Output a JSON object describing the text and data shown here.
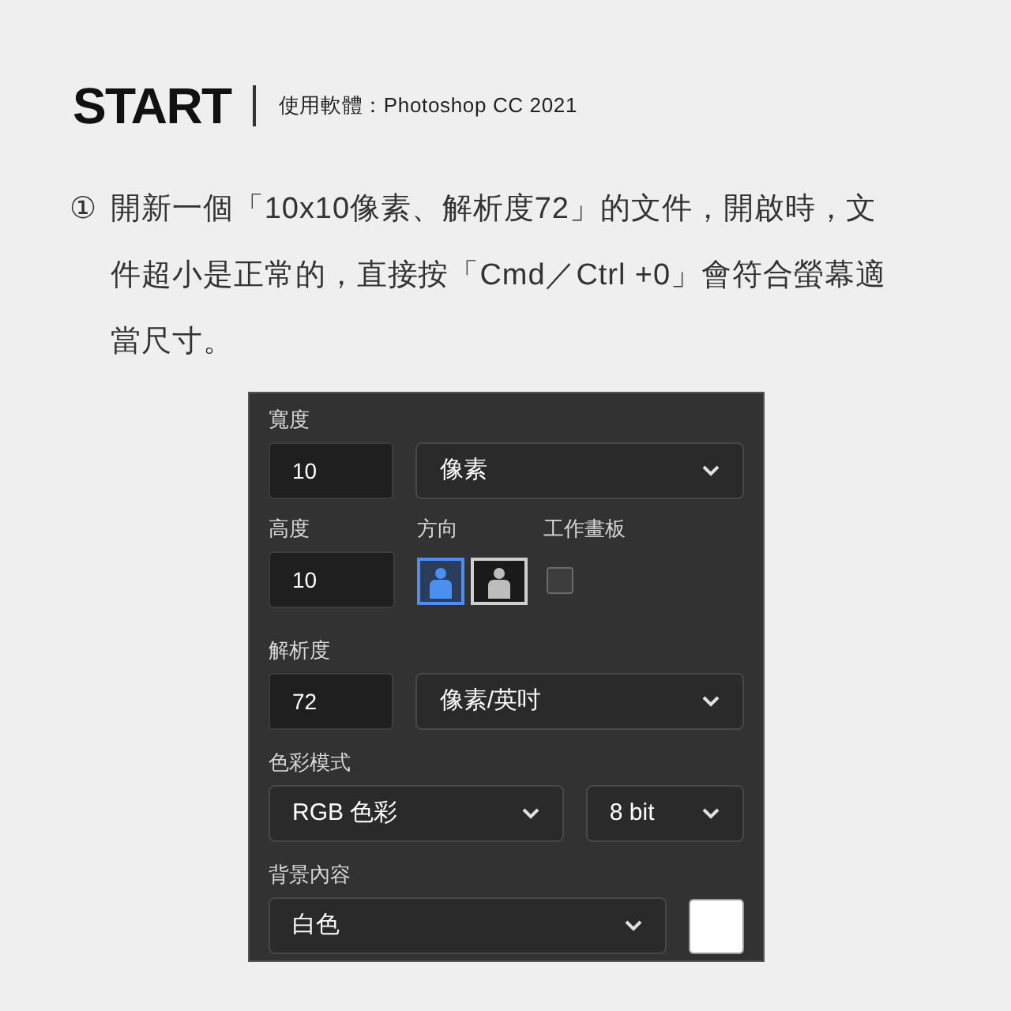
{
  "header": {
    "title": "START",
    "subtitle": "使用軟體：Photoshop CC 2021"
  },
  "step": {
    "marker": "①",
    "text": "開新一個「10x10像素、解析度72」的文件，開啟時，文件超小是正常的，直接按「Cmd／Ctrl +0」會符合螢幕適當尺寸。"
  },
  "dialog": {
    "width": {
      "label": "寬度",
      "value": "10",
      "unit": "像素"
    },
    "height": {
      "label": "高度",
      "value": "10"
    },
    "orientation": {
      "label": "方向",
      "options": [
        {
          "kind": "portrait",
          "selected": true
        },
        {
          "kind": "landscape",
          "selected": false
        }
      ]
    },
    "artboard": {
      "label": "工作畫板",
      "checked": false
    },
    "resolution": {
      "label": "解析度",
      "value": "72",
      "unit": "像素/英吋"
    },
    "color_mode": {
      "label": "色彩模式",
      "mode": "RGB 色彩",
      "depth": "8 bit"
    },
    "background": {
      "label": "背景內容",
      "value": "白色"
    }
  }
}
